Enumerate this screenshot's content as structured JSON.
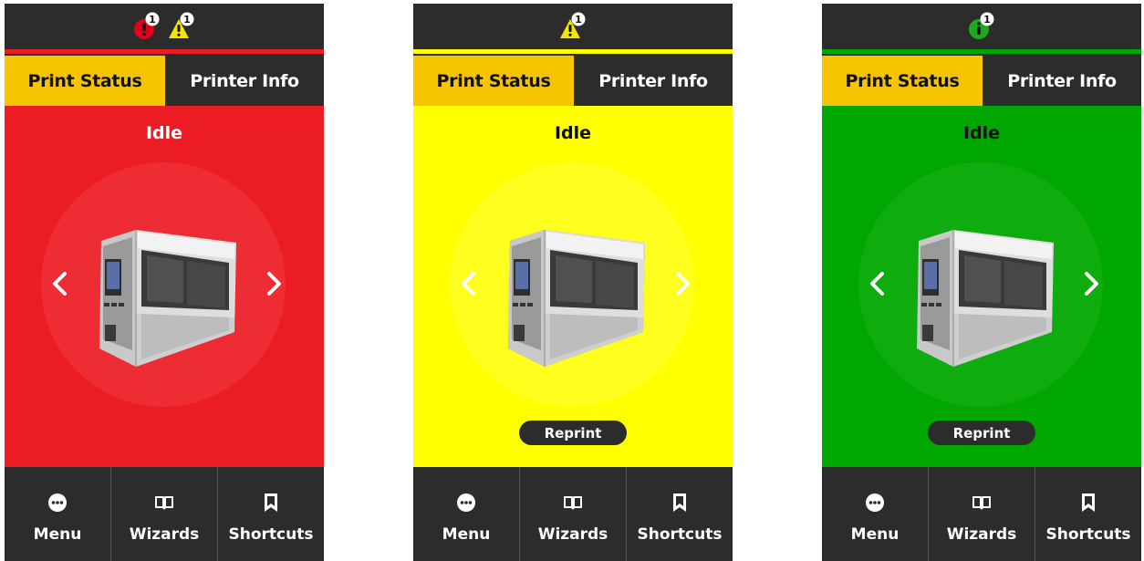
{
  "colors": {
    "bar": "#2c2c2c",
    "tab_active": "#f6c400",
    "red": "#ec1c24",
    "yellow": "#ffff00",
    "green": "#00a700",
    "error_icon": "#e3001b",
    "warning_icon": "#f2e600",
    "info_icon": "#1fa81f"
  },
  "screens": [
    {
      "name": "error",
      "status_icons": [
        {
          "icon": "error-icon",
          "count": "1"
        },
        {
          "icon": "warning-icon",
          "count": "1"
        }
      ],
      "tabs": {
        "print_status": "Print Status",
        "printer_info": "Printer Info"
      },
      "state": "Idle",
      "bottom": {
        "menu": "Menu",
        "wizards": "Wizards",
        "shortcuts": "Shortcuts"
      }
    },
    {
      "name": "warning",
      "status_icons": [
        {
          "icon": "warning-icon",
          "count": "1"
        }
      ],
      "tabs": {
        "print_status": "Print Status",
        "printer_info": "Printer Info"
      },
      "state": "Idle",
      "reprint": "Reprint",
      "bottom": {
        "menu": "Menu",
        "wizards": "Wizards",
        "shortcuts": "Shortcuts"
      }
    },
    {
      "name": "info",
      "status_icons": [
        {
          "icon": "info-icon",
          "count": "1"
        }
      ],
      "tabs": {
        "print_status": "Print Status",
        "printer_info": "Printer Info"
      },
      "state": "Idle",
      "reprint": "Reprint",
      "bottom": {
        "menu": "Menu",
        "wizards": "Wizards",
        "shortcuts": "Shortcuts"
      }
    }
  ]
}
